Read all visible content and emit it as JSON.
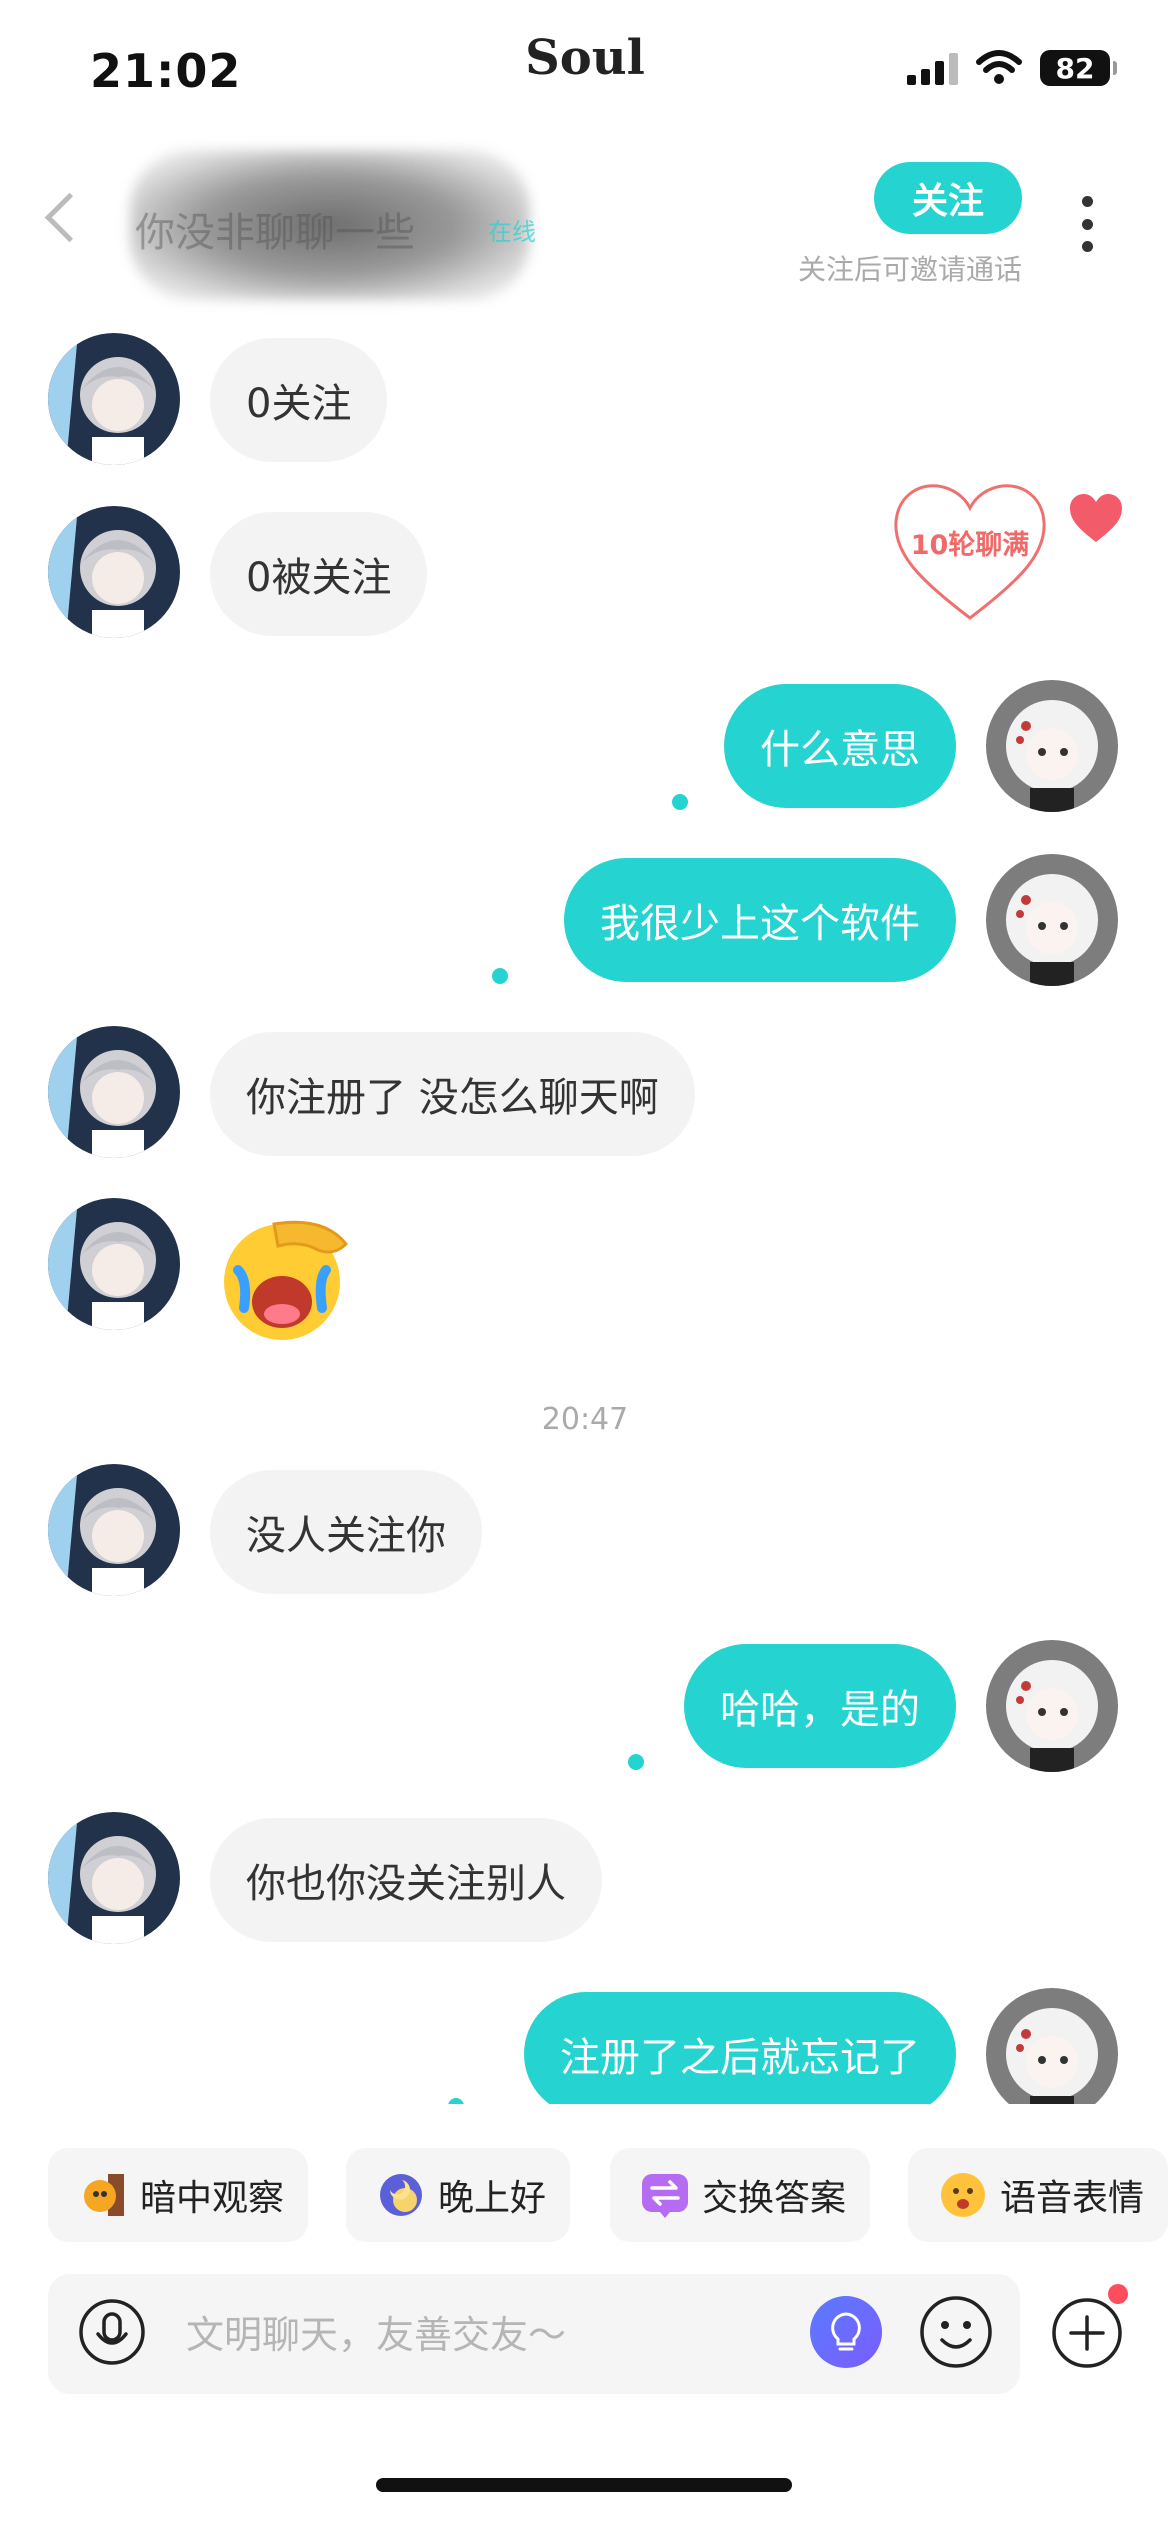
{
  "status_bar": {
    "time": "21:02",
    "app_brand": "Soul",
    "battery": "82"
  },
  "header": {
    "nickname_blurred": "你没非聊聊一些",
    "online_label": "在线",
    "follow_label": "关注",
    "follow_hint": "关注后可邀请通话"
  },
  "intimacy_badge": {
    "label": "10轮聊满"
  },
  "messages": [
    {
      "side": "in",
      "text": "0关注"
    },
    {
      "side": "in",
      "text": "0被关注"
    },
    {
      "side": "out",
      "text": "什么意思"
    },
    {
      "side": "out",
      "text": "我很少上这个软件"
    },
    {
      "side": "in",
      "text": "你注册了 没怎么聊天啊"
    },
    {
      "side": "in",
      "text": "",
      "sticker": "crying-face-emoji"
    },
    {
      "side": "in",
      "text": "没人关注你"
    },
    {
      "side": "out",
      "text": "哈哈，是的"
    },
    {
      "side": "in",
      "text": "你也你没关注别人"
    },
    {
      "side": "out",
      "text": "注册了之后就忘记了"
    }
  ],
  "timestamp": "20:47",
  "quick_replies": [
    {
      "label": "暗中观察",
      "icon": "peeking-cat-icon"
    },
    {
      "label": "晚上好",
      "icon": "moon-icon"
    },
    {
      "label": "交换答案",
      "icon": "exchange-icon"
    },
    {
      "label": "语音表情",
      "icon": "voice-emoji-icon"
    }
  ],
  "input": {
    "placeholder": "文明聊天，友善交友～",
    "value": ""
  },
  "colors": {
    "accent": "#25d4d0",
    "incoming_bubble": "#f3f3f3",
    "heart": "#f06a6a",
    "badge_dot": "#ff4d5e"
  }
}
